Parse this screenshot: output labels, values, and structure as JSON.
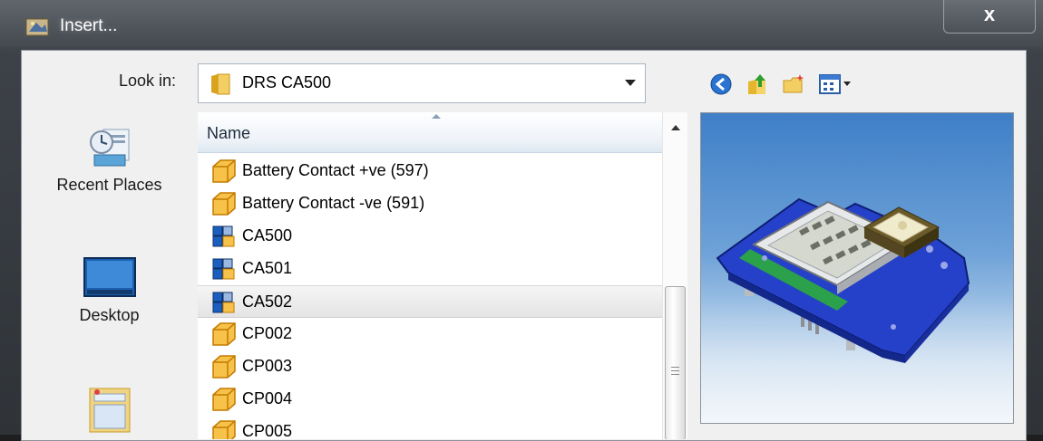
{
  "window": {
    "title": "Insert...",
    "close_label": "x"
  },
  "lookin": {
    "label": "Look in:",
    "value": "DRS CA500"
  },
  "toolbar": {
    "icons": [
      "back-icon",
      "up-folder-icon",
      "new-folder-icon",
      "views-menu-icon"
    ]
  },
  "places": [
    {
      "label": "Recent Places",
      "icon": "recent-places-icon"
    },
    {
      "label": "Desktop",
      "icon": "desktop-icon"
    },
    {
      "label": "",
      "icon": "libraries-icon"
    }
  ],
  "filelist": {
    "column_header": "Name",
    "files": [
      {
        "name": "Battery Contact +ve (597)",
        "type": "part",
        "selected": false
      },
      {
        "name": "Battery Contact -ve (591)",
        "type": "part",
        "selected": false
      },
      {
        "name": "CA500",
        "type": "assembly",
        "selected": false
      },
      {
        "name": "CA501",
        "type": "assembly",
        "selected": false
      },
      {
        "name": "CA502",
        "type": "assembly",
        "selected": true
      },
      {
        "name": "CP002",
        "type": "part",
        "selected": false
      },
      {
        "name": "CP003",
        "type": "part",
        "selected": false
      },
      {
        "name": "CP004",
        "type": "part",
        "selected": false
      },
      {
        "name": "CP005",
        "type": "part",
        "selected": false
      }
    ]
  },
  "preview": {
    "description": "3d-pcb-assembly-preview"
  },
  "colors": {
    "part_icon": "#f0a820",
    "assembly_icon": "#1a5fc0",
    "pcb": "#2541c9"
  }
}
